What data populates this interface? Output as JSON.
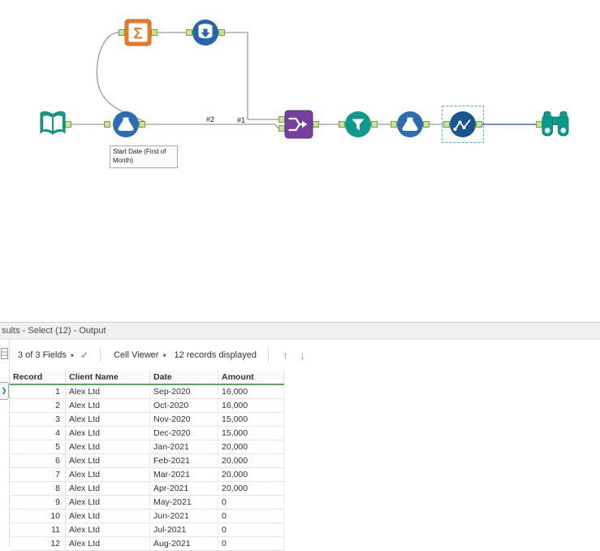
{
  "canvas": {
    "annotation": "Start Date (First of Month)",
    "connection_labels": {
      "hash1": "#1",
      "hash2": "#2"
    },
    "icons": {
      "summarize_glyph": "Σ"
    },
    "tools": [
      "input-data",
      "formula",
      "summarize",
      "generate-rows",
      "join",
      "filter",
      "formula",
      "select",
      "browse"
    ]
  },
  "icons": {
    "caret": "▾",
    "check": "✓",
    "up": "↑",
    "down": "↓",
    "chevron": "❯"
  },
  "results": {
    "title": "sults - Select (12) - Output",
    "toolbar": {
      "fields": "3 of 3 Fields",
      "cell_viewer": "Cell Viewer",
      "records": "12 records displayed"
    },
    "table": {
      "columns": [
        "Record",
        "Client Name",
        "Date",
        "Amount"
      ],
      "rows": [
        [
          "1",
          "Alex Ltd",
          "Sep-2020",
          "16,000"
        ],
        [
          "2",
          "Alex Ltd",
          "Oct-2020",
          "16,000"
        ],
        [
          "3",
          "Alex Ltd",
          "Nov-2020",
          "15,000"
        ],
        [
          "4",
          "Alex Ltd",
          "Dec-2020",
          "15,000"
        ],
        [
          "5",
          "Alex Ltd",
          "Jan-2021",
          "20,000"
        ],
        [
          "6",
          "Alex Ltd",
          "Feb-2021",
          "20,000"
        ],
        [
          "7",
          "Alex Ltd",
          "Mar-2021",
          "20,000"
        ],
        [
          "8",
          "Alex Ltd",
          "Apr-2021",
          "20,000"
        ],
        [
          "9",
          "Alex Ltd",
          "May-2021",
          "0"
        ],
        [
          "10",
          "Alex Ltd",
          "Jun-2021",
          "0"
        ],
        [
          "11",
          "Alex Ltd",
          "Jul-2021",
          "0"
        ],
        [
          "12",
          "Alex Ltd",
          "Aug-2021",
          "0"
        ]
      ]
    }
  },
  "colors": {
    "teal": "#0c9a8d",
    "blue": "#2a6db4",
    "navy": "#19558e",
    "orange": "#e87b2a",
    "purple": "#753f9e",
    "anchor_fill": "#c8e29b",
    "anchor_stroke": "#76a53e",
    "wire": "#9a9a9a",
    "selected_wire": "#4a63c8",
    "selection_dash": "#35b6c9",
    "header_underline": "#5aa55a"
  }
}
